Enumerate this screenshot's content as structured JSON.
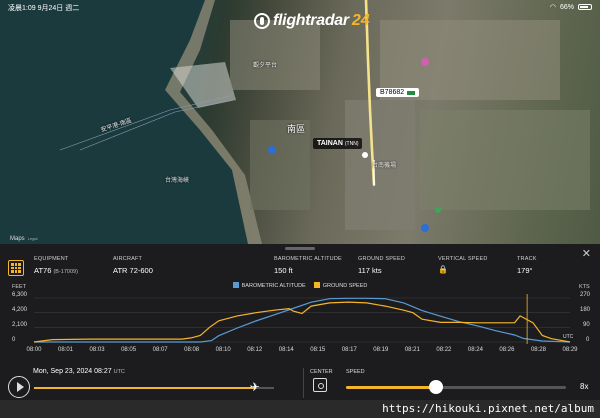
{
  "status_bar": {
    "time": "凌晨1:09",
    "date": "9月24日 週二",
    "battery": "66%"
  },
  "brand": {
    "name": "flightradar",
    "num": "24"
  },
  "map": {
    "callsign": "B78682",
    "airport": "TAINAN",
    "airport_code": "(TNN)",
    "city": "南區",
    "labels": [
      "觀夕平台",
      "台灣海峽",
      "安平港-南區",
      "台南機場"
    ],
    "maps_brand": "Maps",
    "legal": "Legal"
  },
  "stats": {
    "equipment": {
      "label": "EQUIPMENT",
      "value": "AT76",
      "sub": "(B-17009)"
    },
    "aircraft": {
      "label": "AIRCRAFT",
      "value": "ATR 72-600"
    },
    "altitude": {
      "label": "BAROMETRIC ALTITUDE",
      "value": "150 ft"
    },
    "ground_speed": {
      "label": "GROUND SPEED",
      "value": "117 kts"
    },
    "vertical_speed": {
      "label": "VERTICAL SPEED",
      "value": "🔒"
    },
    "track": {
      "label": "TRACK",
      "value": "179°"
    }
  },
  "chart_data": {
    "type": "line",
    "left_axis_title": "FEET",
    "right_axis_title": "KTS",
    "left_ticks": [
      "6,300",
      "4,200",
      "2,100",
      "0"
    ],
    "right_ticks": [
      "270",
      "180",
      "90",
      "0"
    ],
    "x_ticks": [
      "08:00",
      "08:01",
      "08:03",
      "08:05",
      "08:07",
      "08:08",
      "08:10",
      "08:12",
      "08:14",
      "08:15",
      "08:17",
      "08:19",
      "08:21",
      "08:22",
      "08:24",
      "08:26",
      "08:28",
      "08:29"
    ],
    "x_unit": "UTC",
    "ylim_left": [
      0,
      6300
    ],
    "ylim_right": [
      0,
      270
    ],
    "series": [
      {
        "name": "BAROMETRIC ALTITUDE",
        "color": "#5b9bd5",
        "axis": "left",
        "x": [
          0,
          9,
          9.6,
          10,
          11,
          12,
          13,
          14,
          15,
          16,
          17,
          18,
          19,
          20,
          21,
          22,
          23,
          24,
          25,
          26,
          26.5,
          27.5,
          28.5,
          29
        ],
        "y": [
          0,
          0,
          200,
          900,
          2000,
          3000,
          3900,
          4800,
          5700,
          6200,
          6250,
          6250,
          6200,
          5600,
          4500,
          3700,
          2900,
          2300,
          1600,
          1000,
          500,
          150,
          50,
          0
        ]
      },
      {
        "name": "GROUND SPEED",
        "color": "#f5b52b",
        "axis": "right",
        "x": [
          0,
          1,
          3,
          5,
          7,
          8,
          8.5,
          9,
          9.5,
          10,
          11,
          12,
          13,
          13.8,
          14,
          14.5,
          15,
          16,
          17,
          18,
          19,
          20,
          20.5,
          21,
          22,
          23,
          24,
          25,
          26,
          26.3,
          27,
          27.5,
          28,
          29
        ],
        "y": [
          0,
          15,
          18,
          18,
          18,
          18,
          25,
          40,
          90,
          130,
          160,
          180,
          195,
          205,
          190,
          175,
          220,
          240,
          245,
          240,
          220,
          195,
          180,
          140,
          120,
          120,
          118,
          118,
          118,
          160,
          118,
          40,
          20,
          0
        ]
      }
    ]
  },
  "playback": {
    "date": "Mon, Sep 23, 2024",
    "time": "08:27",
    "tz": "UTC",
    "progress": 0.92,
    "center_label": "CENTER",
    "speed_label": "SPEED",
    "speed_value": "8x",
    "speed_fraction": 0.41
  },
  "watermark": "https://hikouki.pixnet.net/album"
}
